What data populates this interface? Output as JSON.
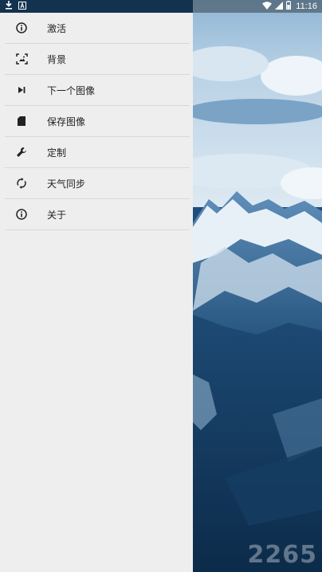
{
  "status_bar": {
    "time": "11:16",
    "icons_left": [
      "download-icon",
      "a-badge-icon"
    ],
    "icons_right": [
      "wifi-icon",
      "signal-icon",
      "battery-icon"
    ]
  },
  "menu": {
    "items": [
      {
        "label": "激活",
        "icon": "info-icon"
      },
      {
        "label": "背景",
        "icon": "wallpaper-icon"
      },
      {
        "label": "下一个图像",
        "icon": "skip-next-icon"
      },
      {
        "label": "保存图像",
        "icon": "sd-card-icon"
      },
      {
        "label": "定制",
        "icon": "wrench-icon"
      },
      {
        "label": "天气同步",
        "icon": "sync-icon"
      },
      {
        "label": "关于",
        "icon": "info-icon"
      }
    ]
  },
  "watermark": "2265",
  "colors": {
    "drawer_bg": "#eeeeee",
    "divider": "#d8d8d8",
    "icon": "#222222",
    "text": "#222222"
  }
}
